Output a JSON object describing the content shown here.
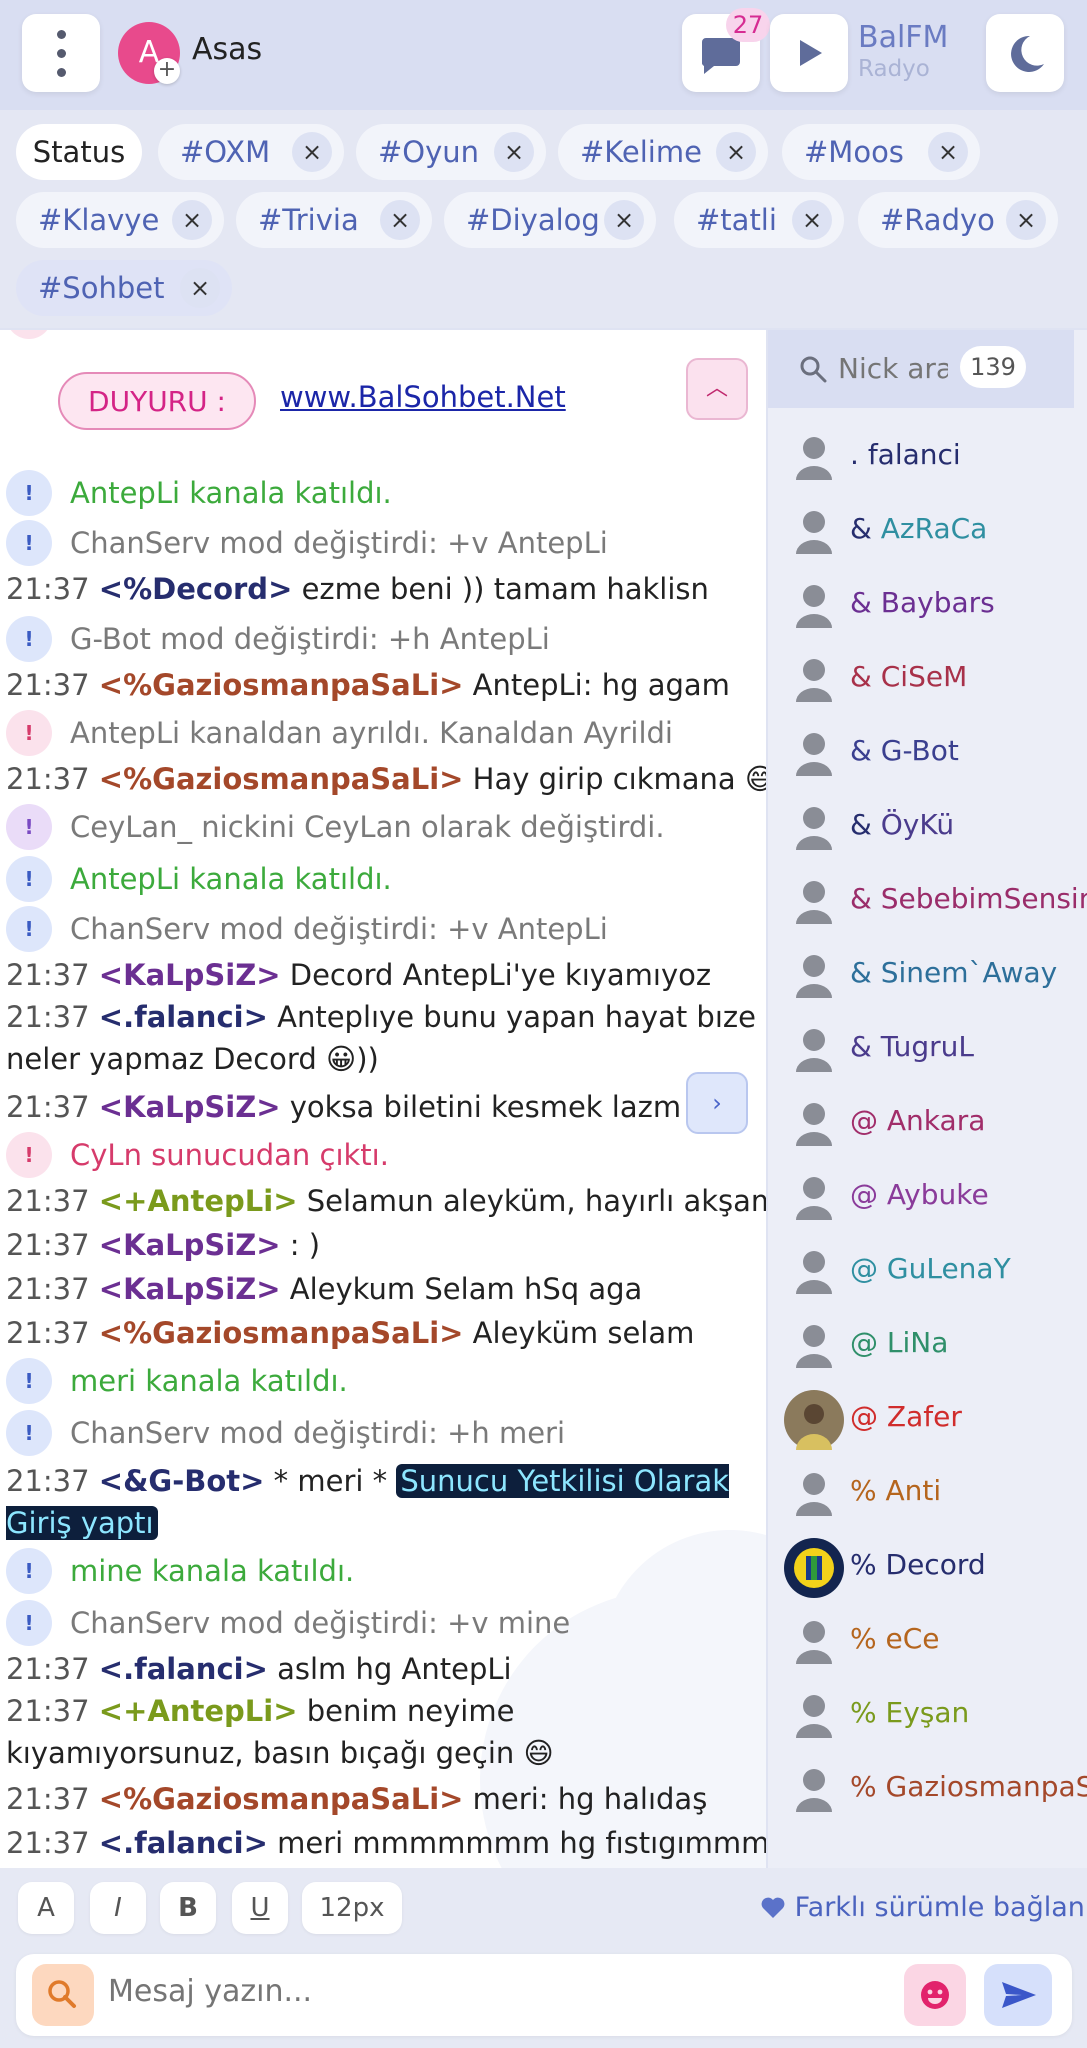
{
  "header": {
    "username": "Asas",
    "avatar_letter": "A",
    "avatar_add": "+",
    "unread_count": "27",
    "radio_name": "BalFM",
    "radio_sub": "Radyo"
  },
  "tabs": [
    {
      "label": "Status"
    },
    {
      "label": "#OXM"
    },
    {
      "label": "#Oyun"
    },
    {
      "label": "#Kelime"
    },
    {
      "label": "#Moos"
    },
    {
      "label": "#Klavye"
    },
    {
      "label": "#Trivia"
    },
    {
      "label": "#Diyalog"
    },
    {
      "label": "#tatli"
    },
    {
      "label": "#Radyo"
    },
    {
      "label": "#Sohbet",
      "active": true
    }
  ],
  "tab_close_symbol": "×",
  "announcement": {
    "label": "DUYURU :",
    "link": "www.BalSohbet.Net"
  },
  "messages": [
    {
      "kind": "sys",
      "icon": "!",
      "text": "AntepLi kanala katıldı."
    },
    {
      "kind": "sys",
      "icon": "!",
      "text": "ChanServ mod değiştirdi: +v AntepLi"
    },
    {
      "kind": "msg",
      "time": "21:37",
      "nick": "<%Decord>",
      "text": " ezme beni )) tamam haklisn"
    },
    {
      "kind": "sys",
      "icon": "!",
      "text": "G-Bot mod değiştirdi: +h AntepLi"
    },
    {
      "kind": "msg",
      "time": "21:37",
      "nick": "<%GaziosmanpaSaLi>",
      "text": " AntepLi: hg agam"
    },
    {
      "kind": "sys",
      "icon": "!",
      "text": "AntepLi kanaldan ayrıldı. Kanaldan Ayrildi"
    },
    {
      "kind": "msg",
      "time": "21:37",
      "nick": "<%GaziosmanpaSaLi>",
      "text": " Hay girip cıkmana 😄"
    },
    {
      "kind": "sys",
      "icon": "!",
      "text": "CeyLan_ nickini CeyLan olarak değiştirdi."
    },
    {
      "kind": "sys",
      "icon": "!",
      "text": "AntepLi kanala katıldı."
    },
    {
      "kind": "sys",
      "icon": "!",
      "text": "ChanServ mod değiştirdi: +v AntepLi"
    },
    {
      "kind": "msg",
      "time": "21:37",
      "nick": "<KaLpSiZ>",
      "text": " Decord  AntepLi'ye kıyamıyoz"
    },
    {
      "kind": "msg",
      "time": "21:37",
      "nick": "<.falanci>",
      "text": " Anteplıye bunu yapan hayat bıze neler yapmaz Decord  😀))"
    },
    {
      "kind": "msg",
      "time": "21:37",
      "nick": "<KaLpSiZ>",
      "text": " yoksa biletini kesmek lazm"
    },
    {
      "kind": "sys",
      "icon": "!",
      "text": "CyLn sunucudan çıktı."
    },
    {
      "kind": "msg",
      "time": "21:37",
      "nick": "<+AntepLi>",
      "text": " Selamun aleyküm, hayırlı akşamlar."
    },
    {
      "kind": "msg",
      "time": "21:37",
      "nick": "<KaLpSiZ>",
      "text": " : )"
    },
    {
      "kind": "msg",
      "time": "21:37",
      "nick": "<KaLpSiZ>",
      "text": " Aleykum Selam hSq aga"
    },
    {
      "kind": "msg",
      "time": "21:37",
      "nick": "<%GaziosmanpaSaLi>",
      "text": " Aleyküm selam"
    },
    {
      "kind": "sys",
      "icon": "!",
      "text": "meri kanala katıldı."
    },
    {
      "kind": "sys",
      "icon": "!",
      "text": "ChanServ mod değiştirdi: +h meri"
    },
    {
      "kind": "msg",
      "time": "21:37",
      "nick": "<&G-Bot>",
      "text": " * meri * ",
      "highlight": "Sunucu Yetkilisi Olarak Giriş yaptı"
    },
    {
      "kind": "sys",
      "icon": "!",
      "text": "mine kanala katıldı."
    },
    {
      "kind": "sys",
      "icon": "!",
      "text": "ChanServ mod değiştirdi: +v mine"
    },
    {
      "kind": "msg",
      "time": "21:37",
      "nick": "<.falanci>",
      "text": " aslm hg AntepLi"
    },
    {
      "kind": "msg",
      "time": "21:37",
      "nick": "<+AntepLi>",
      "text": " benim neyime kıyamıyorsunuz, basın bıçağı geçin 😄"
    },
    {
      "kind": "msg",
      "time": "21:37",
      "nick": "<%GaziosmanpaSaLi>",
      "text": " meri: hg halıdaş"
    },
    {
      "kind": "msg",
      "time": "21:37",
      "nick": "<.falanci>",
      "text": " meri mmmmmmm hg fıstıgımmmm"
    }
  ],
  "userlist": {
    "search_placeholder": "Nick ara",
    "count": "139",
    "users": [
      {
        "prefix": ".",
        "name": "falanci"
      },
      {
        "prefix": "&",
        "name": "AzRaCa"
      },
      {
        "prefix": "&",
        "name": "Baybars"
      },
      {
        "prefix": "&",
        "name": "CiSeM"
      },
      {
        "prefix": "&",
        "name": "G-Bot"
      },
      {
        "prefix": "&",
        "name": "ÖyKü"
      },
      {
        "prefix": "&",
        "name": "SebebimSensin"
      },
      {
        "prefix": "&",
        "name": "Sinem`Away"
      },
      {
        "prefix": "&",
        "name": "TugruL"
      },
      {
        "prefix": "@",
        "name": "Ankara"
      },
      {
        "prefix": "@",
        "name": "Aybuke"
      },
      {
        "prefix": "@",
        "name": "GuLenaY"
      },
      {
        "prefix": "@",
        "name": "LiNa"
      },
      {
        "prefix": "@",
        "name": "Zafer"
      },
      {
        "prefix": "%",
        "name": "Anti"
      },
      {
        "prefix": "%",
        "name": "Decord"
      },
      {
        "prefix": "%",
        "name": "eCe"
      },
      {
        "prefix": "%",
        "name": "Eyşan"
      },
      {
        "prefix": "%",
        "name": "GaziosmanpaS"
      }
    ]
  },
  "footer": {
    "font_label": "A",
    "italic_label": "I",
    "bold_label": "B",
    "underline_label": "U",
    "size_label": "12px",
    "alt_version": "Farklı sürümle bağlan",
    "message_placeholder": "Mesaj yazın..."
  },
  "colors": {
    "nick_purple": "#6b2f92",
    "nick_brown": "#a4482a",
    "nick_navy": "#262d6e",
    "nick_olive": "#7a9a1c",
    "sys_green": "#3caa3c",
    "sys_gray": "#7a7a7a",
    "sys_red": "#d63b6b"
  }
}
